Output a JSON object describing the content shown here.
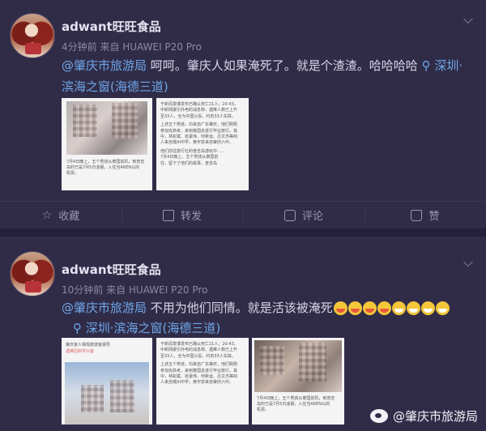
{
  "post1": {
    "username": "adwant旺旺食品",
    "meta": "4分钟前 来自 HUAWEI P20 Pro",
    "mention": "@肇庆市旅游局",
    "text": "呵呵。肇庆人如果淹死了。就是个渣渣。哈哈哈哈",
    "location": "深圳·滨海之窗(海德三道)",
    "thumb2_lines": [
      "于新闻发博发布已确认死亡21人；20:43，",
      "中新网援引外电的消息称，遇难人数已上升",
      "至33人，全为中国公民，约有33人失踪。",
      "上述五个男孩，均来自广东肇庆，他们刚刚",
      "参加完高考，来到泰国去进行毕业旅行。其",
      "中，林彰斌、张豪伟、何希运、吕文杰等四",
      "人来自端州中学，黄宇泉来自肇庆六中。",
      "他们前往旅行社的普吉岛游玩中……",
      "7月4日晚上，五个男孩从泰国前",
      "往，留下了他们的故事，普吉岛"
    ],
    "thumb1_caption": [
      "7月4日晚上，五个男孩从泰国前机，到普吉",
      "岛时已是7月5日凌晨，入住当AREN以的",
      "机票。"
    ]
  },
  "post2": {
    "username": "adwant旺旺食品",
    "meta": "10分钟前 来自 HUAWEI P20 Pro",
    "mention": "@肇庆市旅游局",
    "text": "不用为他们同情。就是活该被淹死",
    "location": "深圳·滨海之窗(海德三道)",
    "thumb1_lines": [
      "肇庆家人相观旅游客报导",
      "遇难回到学兴客"
    ],
    "thumb2_caption": [
      "7月4日晚上，五个男孩从泰国前机，到普吉",
      "岛时已是7月5日凌晨，入住当AREN以的",
      "机票。"
    ]
  },
  "actions": {
    "favorite": "收藏",
    "repost": "转发",
    "comment": "评论",
    "like": "赞"
  },
  "icons": {
    "favorite": "star-icon",
    "repost": "repost-icon",
    "comment": "comment-icon",
    "like": "thumbs-up-icon",
    "location": "location-pin-icon",
    "more": "chevron-down-icon"
  },
  "watermark": {
    "text": "@肇庆市旅游局"
  },
  "colors": {
    "background": "#2b2742",
    "link": "#6fa6e8",
    "emoji": "#f4c63a"
  }
}
